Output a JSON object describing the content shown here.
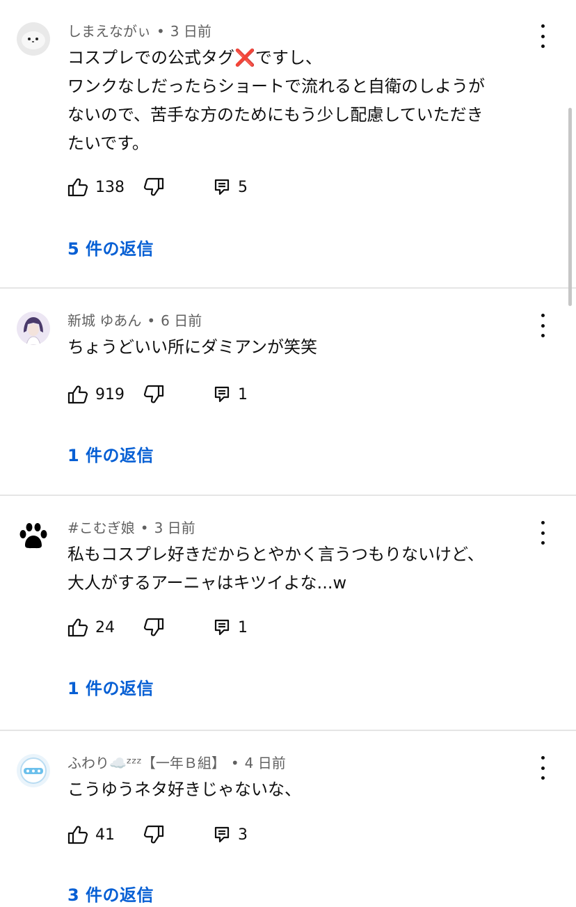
{
  "comments": [
    {
      "author": "しまえながぃ",
      "time": "3 日前",
      "text": "コスプレでの公式タグ❌ですし、\nワンクなしだったらショートで流れると自衛のしようが\nないので、苦手な方のためにもう少し配慮していただき\nたいです。",
      "likes": "138",
      "reply_count": "5",
      "replies_label": "5 件の返信",
      "avatar_icon": "seal-avatar"
    },
    {
      "author": "新城 ゆあん",
      "time": "6 日前",
      "text": "ちょうどいい所にダミアンが笑笑",
      "likes": "919",
      "reply_count": "1",
      "replies_label": "1 件の返信",
      "avatar_icon": "anime-character-avatar"
    },
    {
      "author": "#こむぎ娘",
      "time": "3 日前",
      "text": "私もコスプレ好きだからとやかく言うつもりないけど、\n大人がするアーニャはキツイよな...w",
      "likes": "24",
      "reply_count": "1",
      "replies_label": "1 件の返信",
      "avatar_icon": "paw-print-avatar"
    },
    {
      "author": "ふわり☁️ᶻᶻᶻ【一年Ｂ組】",
      "time": "4 日前",
      "text": "こうゆうネタ好きじゃないな、",
      "likes": "41",
      "reply_count": "3",
      "replies_label": "3 件の返信",
      "avatar_icon": "logo-avatar"
    }
  ],
  "separator": "•",
  "colors": {
    "link_blue": "#065fd4",
    "meta_gray": "#606060",
    "divider": "#e5e5e5"
  }
}
